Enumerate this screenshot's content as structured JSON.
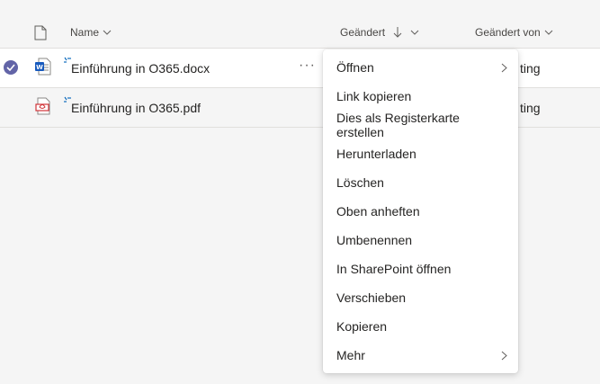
{
  "columns": {
    "name": "Name",
    "modified": "Geändert",
    "modified_by": "Geändert von"
  },
  "files": [
    {
      "name": "Einführung in O365.docx",
      "type": "word",
      "modified_by": "ting"
    },
    {
      "name": "Einführung in O365.pdf",
      "type": "pdf",
      "modified_by": "ting"
    }
  ],
  "row_actions": {
    "more_label": "···"
  },
  "context_menu": {
    "items": [
      {
        "label": "Öffnen",
        "submenu": true
      },
      {
        "label": "Link kopieren",
        "submenu": false
      },
      {
        "label": "Dies als Registerkarte erstellen",
        "submenu": false
      },
      {
        "label": "Herunterladen",
        "submenu": false
      },
      {
        "label": "Löschen",
        "submenu": false
      },
      {
        "label": "Oben anheften",
        "submenu": false
      },
      {
        "label": "Umbenennen",
        "submenu": false
      },
      {
        "label": "In SharePoint öffnen",
        "submenu": false
      },
      {
        "label": "Verschieben",
        "submenu": false
      },
      {
        "label": "Kopieren",
        "submenu": false
      },
      {
        "label": "Mehr",
        "submenu": true
      }
    ]
  },
  "colors": {
    "accent": "#6264a7",
    "word_blue": "#185abd",
    "pdf_red": "#d13438"
  }
}
